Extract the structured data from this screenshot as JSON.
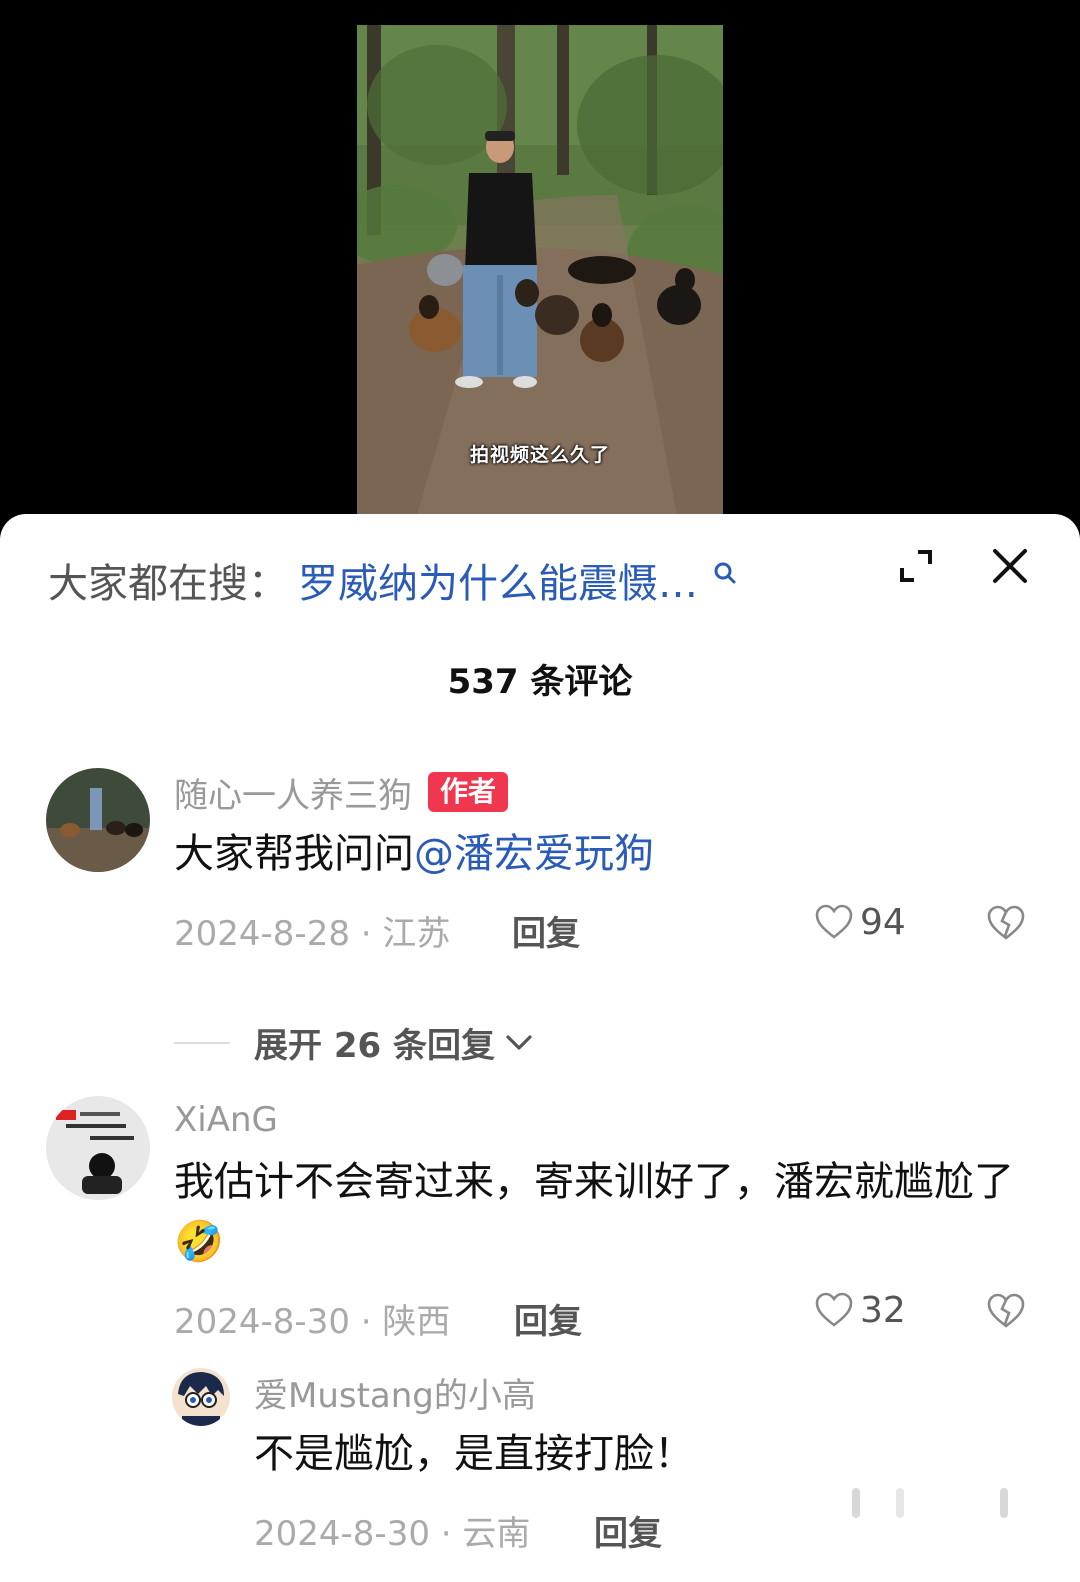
{
  "video": {
    "caption": "拍视频这么久了"
  },
  "search": {
    "prefix": "大家都在搜：",
    "query": "罗威纳为什么能震慑…"
  },
  "header": {
    "comment_count_title": "537 条评论"
  },
  "comments": [
    {
      "username": "随心一人养三狗",
      "badge": "作者",
      "text": "大家帮我问问",
      "mention": "@潘宏爱玩狗",
      "date": "2024-8-28 · 江苏",
      "reply_label": "回复",
      "likes": "94"
    },
    {
      "username": "XiAnG",
      "text": "我估计不会寄过来，寄来训好了，潘宏就尴尬了",
      "emoji": "🤣",
      "date": "2024-8-30 · 陕西",
      "reply_label": "回复",
      "likes": "32"
    }
  ],
  "expand_replies": {
    "label": "展开 26 条回复"
  },
  "reply": {
    "username": "爱Mustang的小高",
    "text": "不是尴尬，是直接打脸！",
    "date": "2024-8-30 · 云南",
    "reply_label": "回复"
  },
  "colors": {
    "link_blue": "#2a5bb8",
    "author_badge": "#f0374f",
    "muted": "#999999"
  }
}
